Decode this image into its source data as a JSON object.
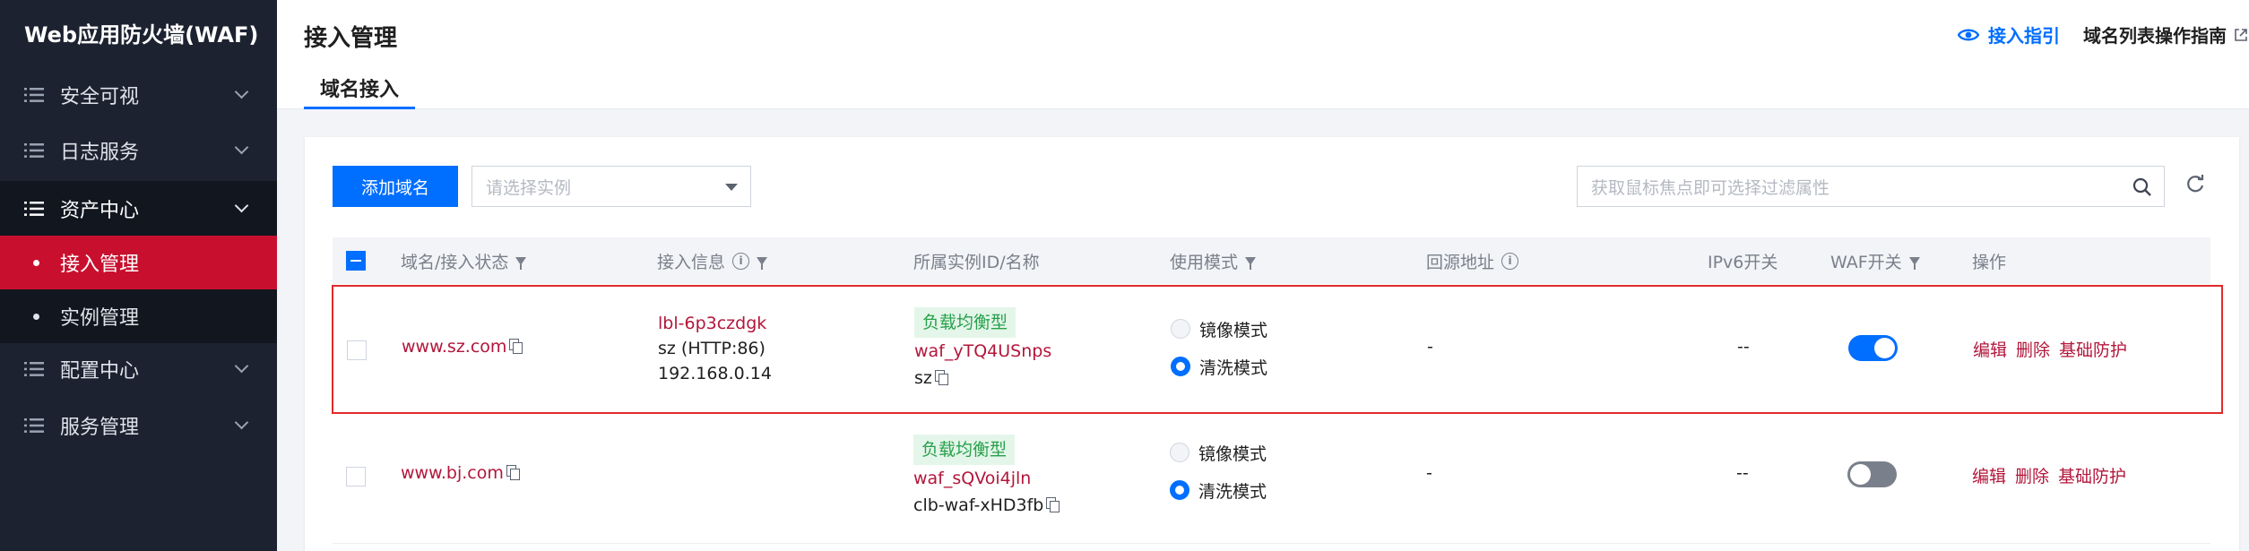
{
  "sidebar": {
    "title": "Web应用防火墙(WAF)",
    "items": [
      {
        "label": "安全可视"
      },
      {
        "label": "日志服务"
      },
      {
        "label": "资产中心"
      },
      {
        "label": "配置中心"
      },
      {
        "label": "服务管理"
      }
    ],
    "subitems": [
      {
        "label": "接入管理"
      },
      {
        "label": "实例管理"
      }
    ]
  },
  "header": {
    "title": "接入管理",
    "guide_link": "接入指引",
    "doc_link": "域名列表操作指南",
    "tab": "域名接入"
  },
  "toolbar": {
    "add_button": "添加域名",
    "select_placeholder": "请选择实例",
    "search_placeholder": "获取鼠标焦点即可选择过滤属性"
  },
  "table": {
    "columns": [
      "域名/接入状态",
      "接入信息",
      "所属实例ID/名称",
      "使用模式",
      "回源地址",
      "IPv6开关",
      "WAF开关",
      "操作"
    ],
    "rows": [
      {
        "domain": "www.sz.com",
        "access_id": "lbl-6p3czdgk",
        "access_proto": "sz (HTTP:86)",
        "access_ip": "192.168.0.14",
        "instance_tag": "负载均衡型",
        "instance_id": "waf_yTQ4USnps",
        "instance_name": "sz",
        "mode_mirror": "镜像模式",
        "mode_clean": "清洗模式",
        "origin": "-",
        "ipv6": "--",
        "waf_on": true,
        "op_edit": "编辑",
        "op_delete": "删除",
        "op_basic": "基础防护"
      },
      {
        "domain": "www.bj.com",
        "access_id": "",
        "access_proto": "",
        "access_ip": "",
        "instance_tag": "负载均衡型",
        "instance_id": "waf_sQVoi4jln",
        "instance_name": "clb-waf-xHD3fb",
        "mode_mirror": "镜像模式",
        "mode_clean": "清洗模式",
        "origin": "-",
        "ipv6": "--",
        "waf_on": false,
        "op_edit": "编辑",
        "op_delete": "删除",
        "op_basic": "基础防护"
      }
    ]
  },
  "colors": {
    "accent": "#006eff",
    "active_nav": "#c8102e",
    "link_red": "#b3163a",
    "tag_green": "#27a04b",
    "highlight_border": "#e02b2b"
  }
}
